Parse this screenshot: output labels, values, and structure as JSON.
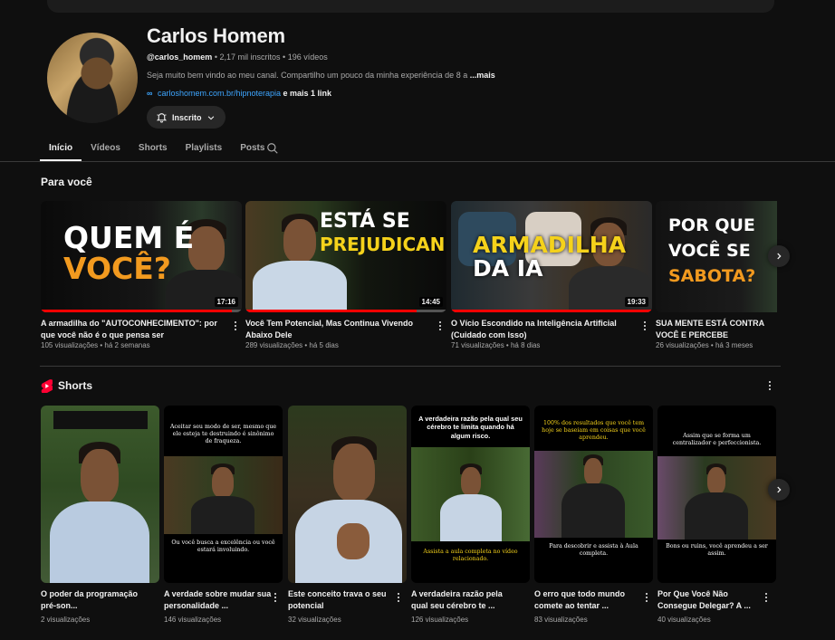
{
  "channel": {
    "name": "Carlos Homem",
    "handle": "@carlos_homem",
    "subscribers": "2,17 mil inscritos",
    "videos_count": "196 vídeos",
    "description": "Seja muito bem vindo ao meu canal. Compartilho um pouco da minha experiência de 8 a",
    "more_label": "...mais",
    "link_url": "carloshomem.com.br/hipnoterapia",
    "link_more": "e mais 1 link",
    "subscribe_label": "Inscrito"
  },
  "tabs": [
    "Início",
    "Vídeos",
    "Shorts",
    "Playlists",
    "Posts"
  ],
  "for_you": {
    "title": "Para você",
    "videos": [
      {
        "thumb_text": [
          "QUEM É",
          "VOCÊ?"
        ],
        "duration": "17:16",
        "progress": 0.95,
        "title": "A armadilha do \"AUTOCONHECIMENTO\": por que você não é o que pensa ser",
        "views": "105 visualizações",
        "age": "há 2 semanas"
      },
      {
        "thumb_text": [
          "ESTÁ SE",
          "PREJUDICANDO"
        ],
        "duration": "14:45",
        "progress": 0.85,
        "title": "Você Tem Potencial, Mas Continua Vivendo Abaixo Dele",
        "views": "289 visualizações",
        "age": "há 5 dias"
      },
      {
        "thumb_text": [
          "ARMADILHA",
          "DA IA"
        ],
        "duration": "19:33",
        "progress": 1.0,
        "title": "O Vício Escondido na Inteligência Artificial (Cuidado com Isso)",
        "views": "71 visualizações",
        "age": "há 8 dias"
      },
      {
        "thumb_text": [
          "POR QUE",
          "VOCÊ SE",
          "SABOTA?"
        ],
        "duration": "",
        "progress": 0,
        "title": "SUA MENTE ESTÁ CONTRA VOCÊ E PERCEBE",
        "views": "26 visualizações",
        "age": "há 3 meses"
      }
    ]
  },
  "shorts": {
    "title": "Shorts",
    "items": [
      {
        "caption_top": "",
        "caption_bottom": "",
        "title": "O poder da programação pré-son...",
        "views": "2 visualizações"
      },
      {
        "caption_top": "Aceitar seu modo de ser, mesmo que ele esteja te destruindo é sinônimo de fraqueza.",
        "caption_bottom": "Ou você busca a excelência ou você estará involuindo.",
        "title": "A verdade sobre mudar sua personalidade ...",
        "views": "146 visualizações"
      },
      {
        "caption_top": "",
        "caption_bottom": "",
        "title": "Este conceito trava o seu potencial",
        "views": "32 visualizações"
      },
      {
        "caption_top": "A verdadeira razão pela qual seu cérebro te limita quando há algum risco.",
        "caption_bottom": "Assista a aula completa no vídeo relacionado.",
        "title": "A verdadeira razão pela qual seu cérebro te ...",
        "views": "126 visualizações"
      },
      {
        "caption_top": "100% dos resultados que você tem hoje se baseiam em coisas que você aprendeu.",
        "caption_bottom": "Para descobrir e assista à Aula completa.",
        "title": "O erro que todo mundo comete ao tentar ...",
        "views": "83 visualizações"
      },
      {
        "caption_top": "Assim que se forma um centralizador e perfeccionista.",
        "caption_bottom": "Bons ou ruins, você aprendeu a ser assim.",
        "title": "Por Que Você Não Consegue Delegar? A ...",
        "views": "40 visualizações"
      }
    ]
  },
  "colors": {
    "accent_red": "#ff0000",
    "yellow": "#f5d21b",
    "orange": "#f29a1f",
    "link_blue": "#3ea6ff"
  }
}
